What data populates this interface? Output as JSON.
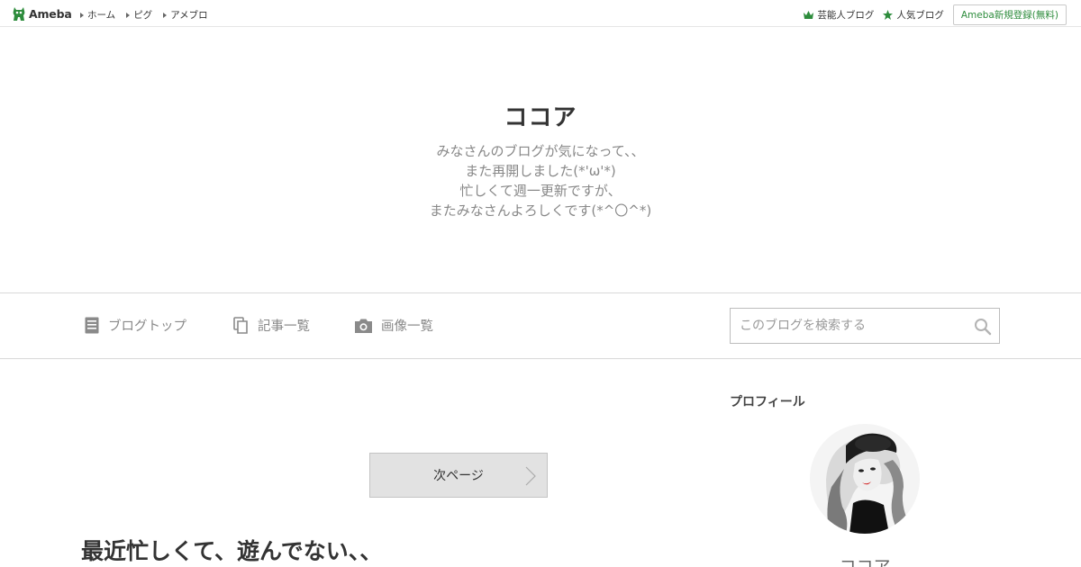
{
  "topbar": {
    "logo_text": "Ameba",
    "nav": [
      {
        "label": "ホーム"
      },
      {
        "label": "ピグ"
      },
      {
        "label": "アメブロ"
      }
    ],
    "right_links": [
      {
        "label": "芸能人ブログ",
        "icon": "crown-icon"
      },
      {
        "label": "人気ブログ",
        "icon": "star-icon"
      }
    ],
    "signup_label": "Ameba新規登録(無料)",
    "accent_color": "#2d8c3c"
  },
  "header": {
    "title": "ココア",
    "description_lines": [
      "みなさんのブログが気になって、、",
      "また再開しました(*'ω'*)",
      "忙しくて週一更新ですが、",
      "またみなさんよろしくです(*^〇^*)"
    ]
  },
  "blog_nav": {
    "items": [
      {
        "label": "ブログトップ",
        "icon": "document-icon"
      },
      {
        "label": "記事一覧",
        "icon": "copy-icon"
      },
      {
        "label": "画像一覧",
        "icon": "camera-icon"
      }
    ],
    "search_placeholder": "このブログを検索する"
  },
  "main": {
    "next_page_label": "次ページ",
    "entry_title": "最近忙しくて、遊んでない、、"
  },
  "sidebar": {
    "profile_heading": "プロフィール",
    "profile_name": "ココア"
  }
}
